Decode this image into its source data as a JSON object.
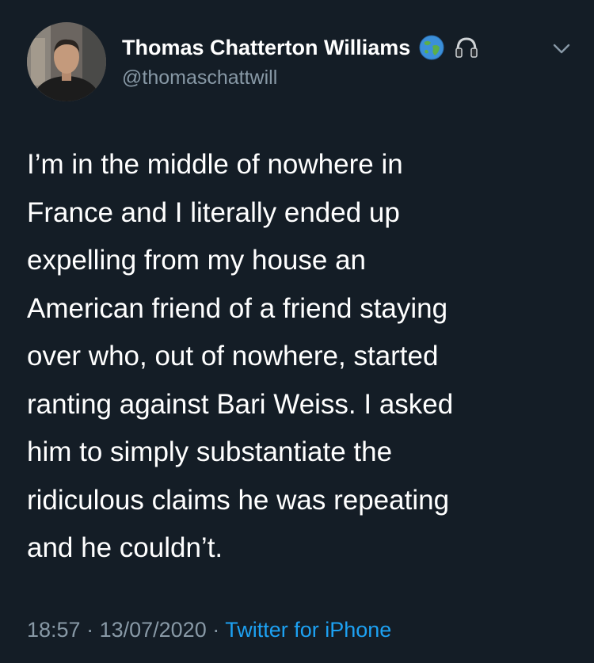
{
  "author": {
    "display_name": "Thomas Chatterton Williams",
    "handle": "@thomaschattwill",
    "avatar_icon": "profile-photo",
    "badges": [
      "globe-icon",
      "headphones-icon"
    ]
  },
  "menu_icon": "chevron-down-icon",
  "tweet": {
    "text": "I’m in the middle of nowhere in\nFrance and I literally ended up\nexpelling from my house an\nAmerican friend of a friend staying\nover who, out of nowhere, started\nranting against Bari Weiss. I asked\nhim to simply substantiate the\nridiculous claims he was repeating\nand he couldn’t."
  },
  "meta": {
    "time": "18:57",
    "separator": " · ",
    "date": "13/07/2020",
    "source": "Twitter for iPhone"
  },
  "colors": {
    "background": "#141d26",
    "text": "#ffffff",
    "secondary": "#8899a6",
    "link": "#1da1f2"
  }
}
